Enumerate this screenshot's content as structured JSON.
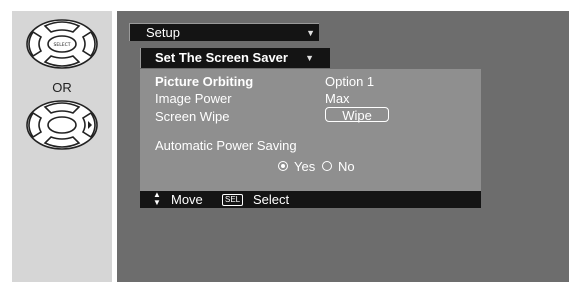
{
  "remote": {
    "or_label": "OR",
    "select_key_label": "SELECT"
  },
  "osd": {
    "setup_menu": "Setup",
    "submenu": "Set The Screen Saver",
    "settings": {
      "picture_orbiting": {
        "label": "Picture Orbiting",
        "value": "Option 1"
      },
      "image_power": {
        "label": "Image Power",
        "value": "Max"
      },
      "screen_wipe": {
        "label": "Screen Wipe",
        "button": "Wipe"
      },
      "auto_power_saving": {
        "label": "Automatic Power Saving",
        "options": [
          "Yes",
          "No"
        ],
        "selected": "Yes"
      }
    },
    "help": {
      "move_label": "Move",
      "sel_key": "SEL",
      "select_label": "Select"
    }
  },
  "colors": {
    "osd_background": "#6d6d6d",
    "settings_panel": "#8f8f8f",
    "menu_bar": "#141414",
    "remote_panel": "#d6d6d6",
    "text": "#ffffff"
  },
  "icons": [
    "remote-select-pad-icon",
    "remote-arrow-pad-icon",
    "dropdown-arrow-icon",
    "radio-selected-icon",
    "radio-empty-icon",
    "move-updown-icon",
    "sel-key-icon"
  ]
}
